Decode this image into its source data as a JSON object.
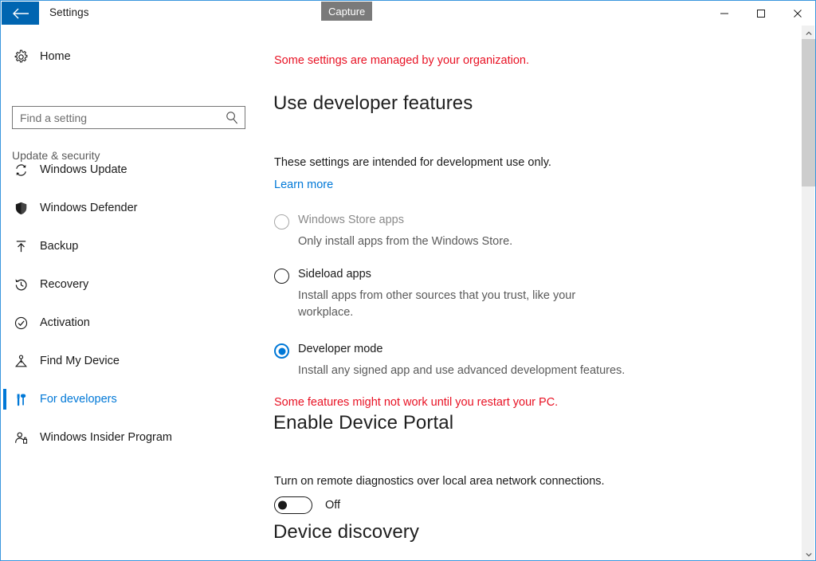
{
  "window": {
    "title": "Settings",
    "back_icon": "back-arrow-icon",
    "capture_tooltip": "Capture",
    "minimize_label": "Minimize",
    "maximize_label": "Maximize",
    "close_label": "Close",
    "frame_color": "#3a96dd",
    "accent_color": "#0078d7",
    "back_button_color": "#0065b1",
    "error_color": "#e81123"
  },
  "sidebar": {
    "home": {
      "label": "Home",
      "icon": "gear-icon"
    },
    "search": {
      "placeholder": "Find a setting",
      "value": "",
      "icon": "search-icon"
    },
    "section_label": "Update & security",
    "items": [
      {
        "label": "Windows Update",
        "icon": "refresh-icon",
        "selected": false
      },
      {
        "label": "Windows Defender",
        "icon": "shield-icon",
        "selected": false
      },
      {
        "label": "Backup",
        "icon": "upload-arrow-icon",
        "selected": false
      },
      {
        "label": "Recovery",
        "icon": "history-clock-icon",
        "selected": false
      },
      {
        "label": "Activation",
        "icon": "check-circle-icon",
        "selected": false
      },
      {
        "label": "Find My Device",
        "icon": "locate-person-icon",
        "selected": false
      },
      {
        "label": "For developers",
        "icon": "tools-icon",
        "selected": true
      },
      {
        "label": "Windows Insider Program",
        "icon": "person-badge-icon",
        "selected": false
      }
    ]
  },
  "main": {
    "managed_note": "Some settings are managed by your organization.",
    "developer_features": {
      "heading": "Use developer features",
      "intro": "These settings are intended for development use only.",
      "learn_more": "Learn more",
      "options": [
        {
          "label": "Windows Store apps",
          "description": "Only install apps from the Windows Store.",
          "checked": false,
          "disabled": true
        },
        {
          "label": "Sideload apps",
          "description": "Install apps from other sources that you trust, like your workplace.",
          "checked": false,
          "disabled": false
        },
        {
          "label": "Developer mode",
          "description": "Install any signed app and use advanced development features.",
          "checked": true,
          "disabled": false
        }
      ],
      "restart_note": "Some features might not work until you restart your PC."
    },
    "device_portal": {
      "heading": "Enable Device Portal",
      "description": "Turn on remote diagnostics over local area network connections.",
      "toggle_state": "Off",
      "toggle_on": false
    },
    "device_discovery": {
      "heading": "Device discovery"
    }
  },
  "scrollbar": {
    "up_arrow": "chevron-up-icon",
    "down_arrow": "chevron-down-icon",
    "thumb": "scrollbar-thumb"
  }
}
